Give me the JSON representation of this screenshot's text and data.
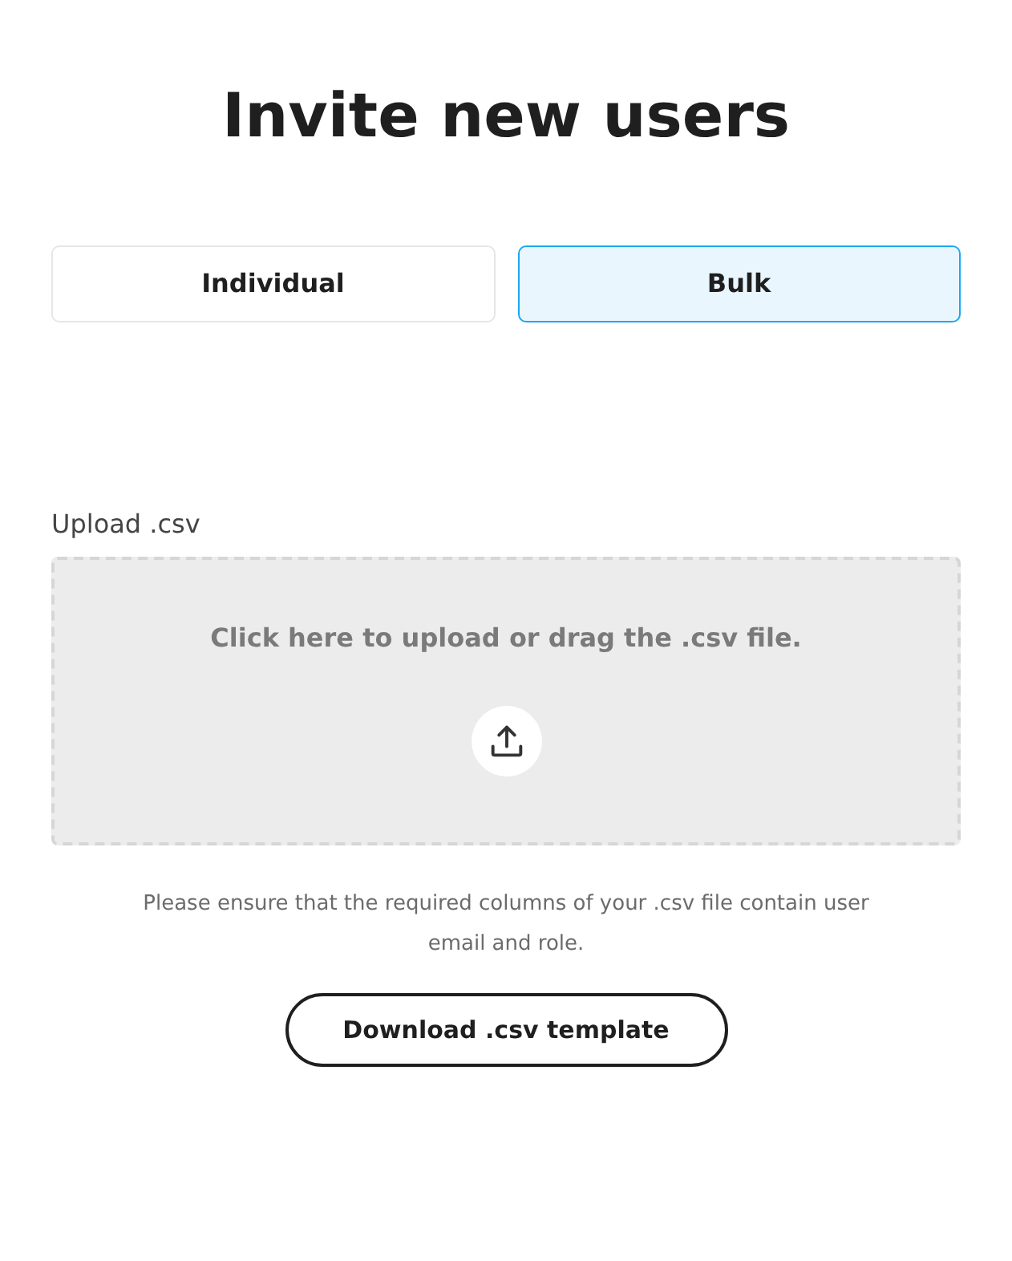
{
  "title": "Invite new users",
  "tabs": [
    {
      "label": "Individual",
      "selected": false
    },
    {
      "label": "Bulk",
      "selected": true
    }
  ],
  "upload": {
    "label": "Upload .csv",
    "prompt": "Click here to upload or drag the .csv file."
  },
  "note": "Please ensure that the required columns of your .csv file contain user email and role.",
  "button": "Download .csv template"
}
